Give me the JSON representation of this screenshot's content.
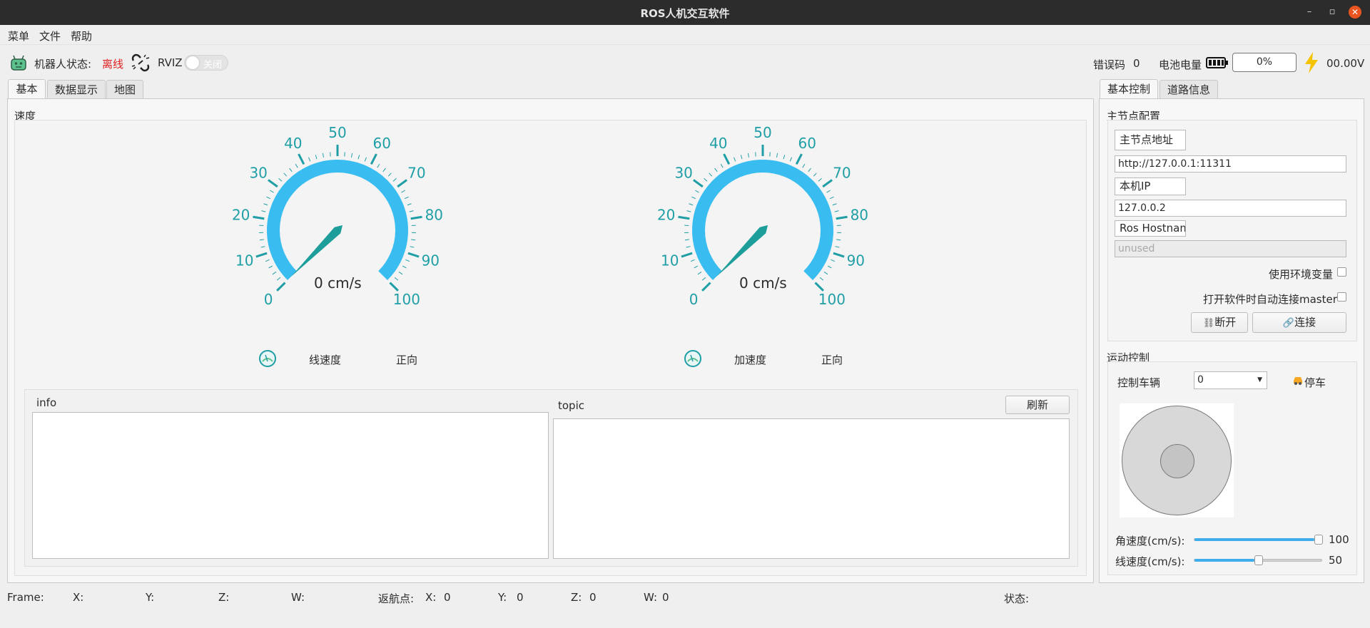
{
  "window": {
    "title": "ROS人机交互软件",
    "buttons": {
      "minimize": "–",
      "maximize": "▫",
      "close": "✕"
    }
  },
  "menu": [
    "菜单",
    "文件",
    "帮助"
  ],
  "status": {
    "robot_state_label": "机器人状态:",
    "robot_state_value": "离线",
    "rviz_label": "RVIZ",
    "rviz_toggle": "关闭",
    "rviz_toggle_on": false,
    "error_code_label": "错误码",
    "error_code_value": "0",
    "battery_label": "电池电量",
    "battery_percent": "0%",
    "voltage": "00.00V",
    "colors": {
      "offline": "#e02020",
      "battery_bolt": "#f5c400"
    }
  },
  "left_tabs": [
    "基本",
    "数据显示",
    "地图"
  ],
  "speed_group": {
    "title": "速度",
    "gauges": [
      {
        "value_text": "0 cm/s",
        "value": 0,
        "label": "线速度",
        "direction": "正向"
      },
      {
        "value_text": "0 cm/s",
        "value": 0,
        "label": "加速度",
        "direction": "正向"
      }
    ],
    "scale_labels": [
      "0",
      "10",
      "20",
      "30",
      "40",
      "50",
      "60",
      "70",
      "80",
      "90",
      "100"
    ],
    "colors": {
      "arc": "#39bdf1",
      "tick": "#1f9ea6",
      "needle": "#1e9e9a"
    }
  },
  "info": {
    "title": "info"
  },
  "topic": {
    "title": "topic",
    "refresh_button": "刷新"
  },
  "right_tabs": [
    "基本控制",
    "道路信息"
  ],
  "master_config": {
    "title": "主节点配置",
    "master_address_label": "主节点地址",
    "master_address_value": "http://127.0.0.1:11311",
    "local_ip_label": "本机IP",
    "local_ip_value": "127.0.0.2",
    "hostname_label": "Ros Hostname",
    "hostname_placeholder": "unused",
    "use_env_label": "使用环境变量",
    "auto_connect_label": "打开软件时自动连接master",
    "disconnect_button": "断开",
    "connect_button": "连接"
  },
  "motion_control": {
    "title": "运动控制",
    "vehicle_label": "控制车辆",
    "vehicle_value": "0",
    "stop_label": "停车",
    "angular_speed_label": "角速度(cm/s):",
    "angular_speed_value": "100",
    "angular_speed_fraction": 1.0,
    "linear_speed_label": "线速度(cm/s):",
    "linear_speed_value": "50",
    "linear_speed_fraction": 0.5
  },
  "footer": {
    "frame_label": "Frame:",
    "x_label": "X:",
    "y_label": "Y:",
    "z_label": "Z:",
    "w_label": "W:",
    "return_label": "返航点:",
    "rx_label": "X:",
    "rx_value": "0",
    "ry_label": "Y:",
    "ry_value": "0",
    "rz_label": "Z:",
    "rz_value": "0",
    "rw_label": "W:",
    "rw_value": "0",
    "state_label": "状态:"
  }
}
